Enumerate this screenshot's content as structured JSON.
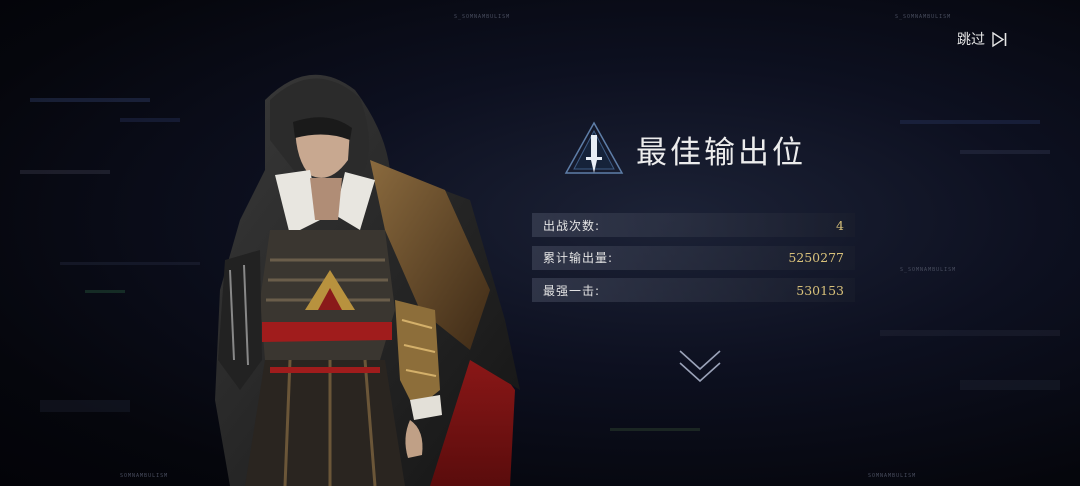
{
  "skip": {
    "label": "跳过",
    "icon": "skip-forward-icon"
  },
  "result": {
    "title": "最佳输出位",
    "emblem_icon": "dagger-triangle-icon",
    "stats": [
      {
        "label": "出战次数:",
        "value": "4"
      },
      {
        "label": "累计输出量:",
        "value": "5250277"
      },
      {
        "label": "最强一击:",
        "value": "530153"
      }
    ]
  },
  "next_icon": "chevron-double-down-icon",
  "colors": {
    "value_gold": "#d7c07a",
    "accent_red": "#9a1c1c",
    "emblem_blue": "#5e7ea8"
  }
}
